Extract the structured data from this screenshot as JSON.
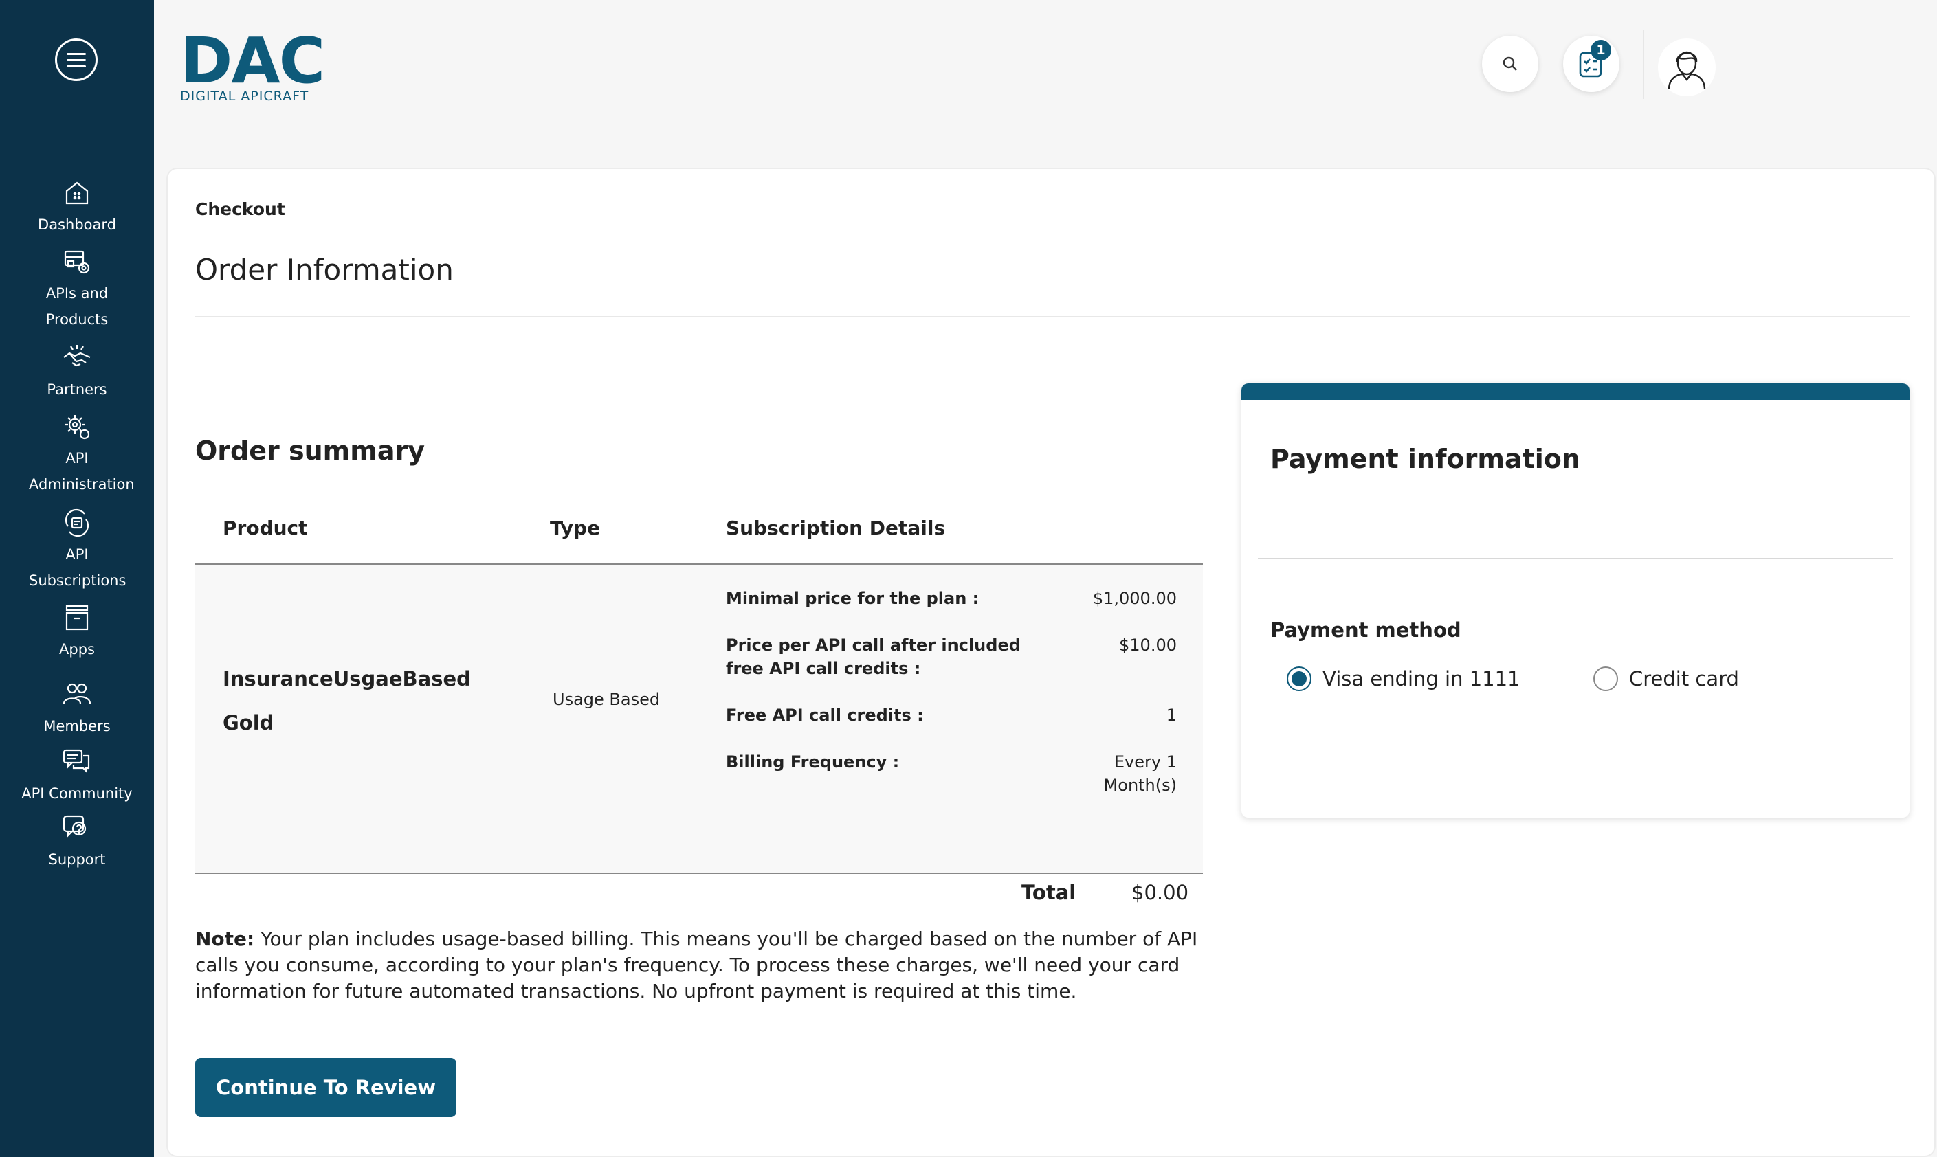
{
  "brand": {
    "logo_text": "DAC",
    "logo_subtitle": "DIGITAL APICRAFT",
    "accent_color": "#0e5a7a",
    "sidebar_color": "#0c3249"
  },
  "sidebar": {
    "items": [
      {
        "label": "Dashboard",
        "icon": "home-icon"
      },
      {
        "label": "APIs and Products",
        "icon": "api-products-icon"
      },
      {
        "label": "Partners",
        "icon": "handshake-icon"
      },
      {
        "label": "API Administration",
        "icon": "gear-icon"
      },
      {
        "label": "API Subscriptions",
        "icon": "subscription-icon"
      },
      {
        "label": "Apps",
        "icon": "box-icon"
      },
      {
        "label": "Members",
        "icon": "people-icon"
      },
      {
        "label": "API Community",
        "icon": "chat-icon"
      },
      {
        "label": "Support",
        "icon": "support-icon"
      }
    ]
  },
  "header": {
    "notification_count": "1"
  },
  "page": {
    "breadcrumb": "Checkout",
    "title": "Order Information"
  },
  "order": {
    "title": "Order summary",
    "columns": [
      "Product",
      "Type",
      "Subscription Details"
    ],
    "product_name_line1": "InsuranceUsgaeBased",
    "product_name_line2": "Gold",
    "type": "Usage Based",
    "details": [
      {
        "label": "Minimal price for the plan :",
        "value": "$1,000.00"
      },
      {
        "label": "Price per API call after included free API call credits :",
        "value": "$10.00"
      },
      {
        "label": "Free API call credits :",
        "value": "1"
      },
      {
        "label": "Billing Frequency :",
        "value": "Every 1 Month(s)"
      }
    ],
    "total_label": "Total",
    "total_value": "$0.00",
    "note_prefix": "Note:",
    "note_text": " Your plan includes usage-based billing. This means you'll be charged based on the number of API calls you consume, according to your plan's frequency. To process these charges, we'll need your card information for future automated transactions. No upfront payment is required at this time.",
    "continue_label": "Continue To Review"
  },
  "payment": {
    "title": "Payment information",
    "method_label": "Payment method",
    "options": [
      {
        "label": "Visa ending in 1111",
        "selected": true
      },
      {
        "label": "Credit card",
        "selected": false
      }
    ]
  }
}
